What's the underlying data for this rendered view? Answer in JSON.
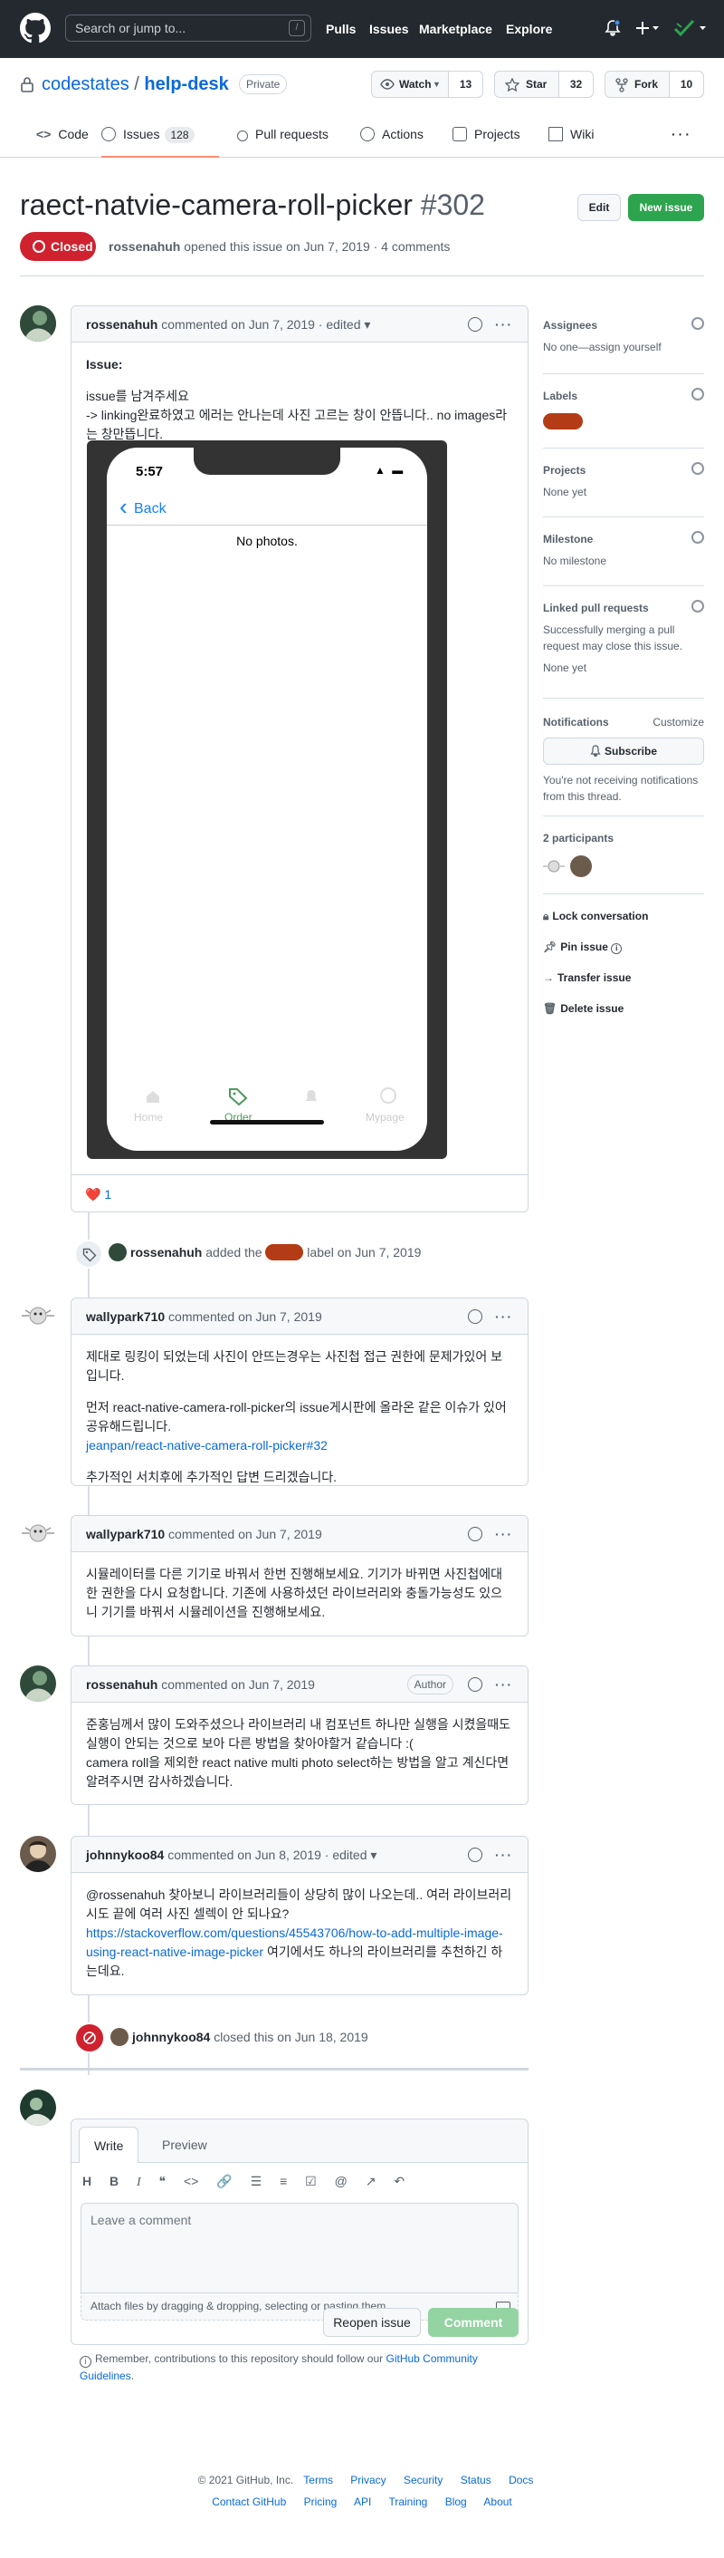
{
  "header": {
    "search_placeholder": "Search or jump to...",
    "slash_key": "/",
    "nav": [
      "Pulls",
      "Issues",
      "Marketplace",
      "Explore"
    ]
  },
  "repo": {
    "owner": "codestates",
    "separator": "/",
    "name": "help-desk",
    "visibility": "Private",
    "watch_label": "Watch",
    "watch_count": "13",
    "star_label": "Star",
    "star_count": "32",
    "fork_label": "Fork",
    "fork_count": "10"
  },
  "tabs": [
    {
      "label": "Code"
    },
    {
      "label": "Issues",
      "count": "128"
    },
    {
      "label": "Pull requests"
    },
    {
      "label": "Actions"
    },
    {
      "label": "Projects"
    },
    {
      "label": "Wiki"
    }
  ],
  "issue": {
    "title": "raect-natvie-camera-roll-picker",
    "number": "#302",
    "edit_label": "Edit",
    "new_issue_label": "New issue",
    "state": "Closed",
    "author": "rossenahuh",
    "meta_text": " opened this issue on Jun 7, 2019 · 4 comments"
  },
  "first_comment": {
    "author": "rossenahuh",
    "header_text": " commented on Jun 7, 2019 · edited ▾",
    "issue_label": "Issue:",
    "line1": "issue를 남겨주세요",
    "line2": "-> linking완료하였고 에러는 안나는데 사진 고르는 창이 안뜹니다.. no images라는 창만뜹니다.",
    "reaction": "❤️",
    "reaction_count": "1",
    "screenshot": {
      "time": "5:57",
      "back": "Back",
      "empty_text": "No photos.",
      "tabbar": [
        "Home",
        "Order",
        "",
        "Mypage"
      ]
    }
  },
  "label_event": {
    "actor": "rossenahuh",
    "before": " added the ",
    "after": " label on Jun 7, 2019",
    "label_color": "#b33c16"
  },
  "comments": [
    {
      "author": "wallypark710",
      "header_text": " commented on Jun 7, 2019",
      "p1": "제대로 링킹이 되었는데 사진이 안뜨는경우는 사진첩 접근 권한에 문제가있어 보입니다.",
      "p2": "먼저 react-native-camera-roll-picker의 issue게시판에 올라온 같은 이슈가 있어 공유해드립니다.",
      "link": "jeanpan/react-native-camera-roll-picker#32",
      "p3": "추가적인 서치후에 추가적인 답변 드리겠습니다."
    },
    {
      "author": "wallypark710",
      "header_text": " commented on Jun 7, 2019",
      "p1": "시뮬레이터를 다른 기기로 바꿔서 한번 진행해보세요. 기기가 바뀌면 사진첩에대한 권한을 다시 요청합니다. 기존에 사용하셨던 라이브러리와 충돌가능성도 있으니 기기를 바꿔서 시뮬레이션을 진행해보세요."
    },
    {
      "author": "rossenahuh",
      "header_text": " commented on Jun 7, 2019",
      "badge": "Author",
      "p1": "준홍님께서 많이 도와주셨으나 라이브러리 내 컴포넌트 하나만 실행을 시켰을때도 실행이 안되는 것으로 보아 다른 방법을 찾아야할거 같습니다 :(",
      "p2": "camera roll을 제외한 react native multi photo select하는 방법을 알고 계신다면 알려주시면 감사하겠습니다."
    },
    {
      "author": "johnnykoo84",
      "header_text": " commented on Jun 8, 2019 · edited ▾",
      "p1": "@rossenahuh 찾아보니 라이브러리들이 상당히 많이 나오는데.. 여러 라이브러리 시도 끝에 여러 사진 셀렉이 안 되나요?",
      "link": "https://stackoverflow.com/questions/45543706/how-to-add-multiple-image-using-react-native-image-picker",
      "p2": " 여기에서도 하나의 라이브러리를 추천하긴 하는데요."
    }
  ],
  "closed_event": {
    "actor": "johnnykoo84",
    "text": " closed this on Jun 18, 2019"
  },
  "form": {
    "write_tab": "Write",
    "preview_tab": "Preview",
    "placeholder": "Leave a comment",
    "attach_text": "Attach files by dragging & dropping, selecting or pasting them.",
    "reopen_label": "Reopen issue",
    "comment_label": "Comment",
    "note_before": "Remember, contributions to this repository should follow our ",
    "note_link": "GitHub Community Guidelines",
    "note_after": "."
  },
  "sidebar": {
    "assignees_h": "Assignees",
    "assignees_v": "No one—assign yourself",
    "labels_h": "Labels",
    "projects_h": "Projects",
    "projects_v": "None yet",
    "milestone_h": "Milestone",
    "milestone_v": "No milestone",
    "linked_h": "Linked pull requests",
    "linked_v1": "Successfully merging a pull request may close this issue.",
    "linked_v2": "None yet",
    "notifications_h": "Notifications",
    "customize": "Customize",
    "subscribe": "Subscribe",
    "notif_text": "You're not receiving notifications from this thread.",
    "participants_h": "2 participants",
    "lock": "Lock conversation",
    "pin": "Pin issue",
    "transfer": "Transfer issue",
    "delete": "Delete issue"
  },
  "footer": {
    "copyright": "© 2021 GitHub, Inc.",
    "row1": [
      "Terms",
      "Privacy",
      "Security",
      "Status",
      "Docs"
    ],
    "row2": [
      "Contact GitHub",
      "Pricing",
      "API",
      "Training",
      "Blog",
      "About"
    ]
  }
}
